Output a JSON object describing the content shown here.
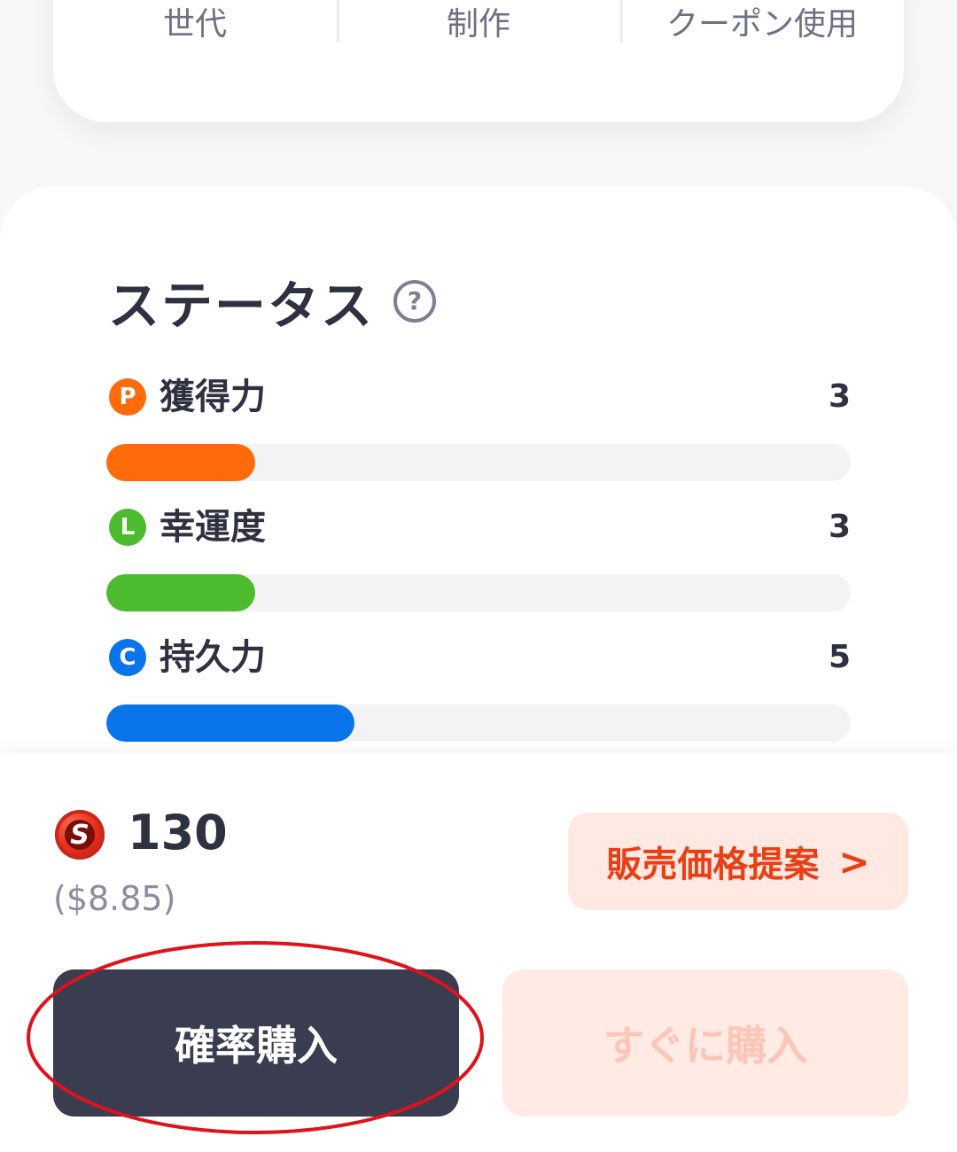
{
  "top_tabs": [
    "世代",
    "制作",
    "クーポン使用"
  ],
  "status": {
    "title": "ステータス",
    "help_icon": "question-circle-icon",
    "stats": [
      {
        "badge": "P",
        "label": "獲得力",
        "value": "3",
        "fill": 0.2,
        "color": "#ff6a0a"
      },
      {
        "badge": "L",
        "label": "幸運度",
        "value": "3",
        "fill": 0.2,
        "color": "#4cbb2e"
      },
      {
        "badge": "C",
        "label": "持久力",
        "value": "5",
        "fill": 0.333,
        "color": "#0a74ea"
      }
    ]
  },
  "purchase": {
    "coin_icon": "s-coin-icon",
    "coin_letter": "S",
    "price": "130",
    "price_usd": "($8.85)",
    "offer_label": "販売価格提案",
    "offer_chevron": ">",
    "probability_buy_label": "確率購入",
    "buy_now_label": "すぐに購入"
  },
  "colors": {
    "accent": "#ea3e14",
    "dark_button": "#3a3c4f",
    "annotation": "#e0121b"
  }
}
